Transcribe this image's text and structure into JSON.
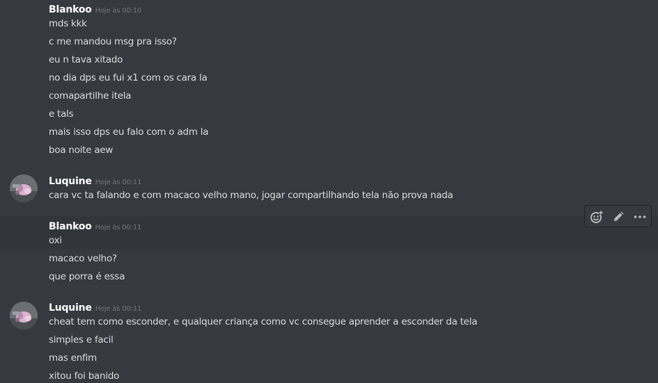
{
  "messages": [
    {
      "author": "Blankoo",
      "timestamp": "Hoje às 00:10",
      "lines": [
        "mds kkk",
        "c me mandou msg pra isso?",
        "eu n tava xitado",
        "no dia dps eu fui x1 com os cara la",
        "comapartilhe itela",
        "e tals",
        "mais isso dps eu falo com o adm la",
        "boa noite aew"
      ]
    },
    {
      "author": "Luquine",
      "timestamp": "Hoje às 00:11",
      "lines": [
        "cara vc ta falando e com macaco velho mano, jogar compartilhando tela não prova nada"
      ]
    },
    {
      "author": "Blankoo",
      "timestamp": "Hoje às 00:11",
      "lines": [
        "oxi",
        "macaco velho?",
        "que porra é essa"
      ]
    },
    {
      "author": "Luquine",
      "timestamp": "Hoje às 00:11",
      "lines": [
        "cheat tem como esconder, e qualquer criança como vc consegue aprender a esconder da tela",
        "simples e facil",
        "mas enfim",
        "xitou foi banido"
      ]
    }
  ],
  "toolbar": {
    "icons": [
      "add-reaction-icon",
      "edit-pencil-icon",
      "more-options-icon"
    ]
  },
  "colors": {
    "background": "#36393f",
    "hover_background": "#32353b",
    "username": "#ffffff",
    "message_text": "#dcddde",
    "timestamp": "#72767d",
    "icon": "#b9bbbe"
  }
}
